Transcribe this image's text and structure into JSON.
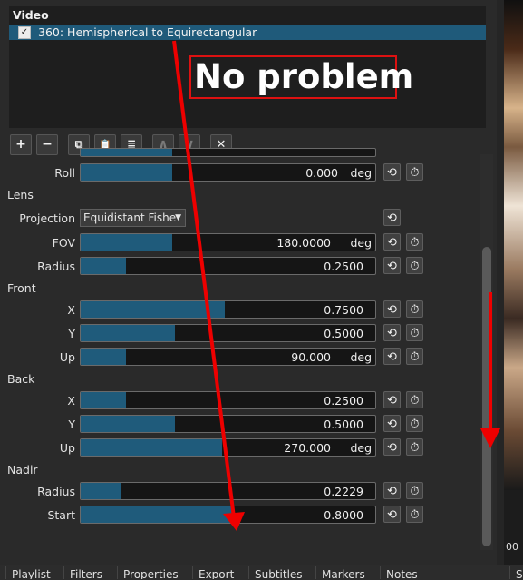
{
  "filter_panel": {
    "header": "Video",
    "selected_filter": "360: Hemispherical to Equirectangular",
    "check_glyph": "✓"
  },
  "toolbar": {
    "add": "+",
    "remove": "−",
    "copy": "⧉",
    "paste": "📋",
    "presets": "≣",
    "up": "∧",
    "down": "∨",
    "close": "✕"
  },
  "params": {
    "roll": {
      "label": "Roll",
      "value": "0.000",
      "unit": "deg",
      "level": 0.31
    },
    "lens_section": "Lens",
    "projection": {
      "label": "Projection",
      "value": "Equidistant Fishe"
    },
    "fov": {
      "label": "FOV",
      "value": "180.0000",
      "unit": "deg",
      "level": 0.31
    },
    "lens_radius": {
      "label": "Radius",
      "value": "0.2500",
      "level": 0.155
    },
    "front_section": "Front",
    "front_x": {
      "label": "X",
      "value": "0.7500",
      "level": 0.49
    },
    "front_y": {
      "label": "Y",
      "value": "0.5000",
      "level": 0.32
    },
    "front_up": {
      "label": "Up",
      "value": "90.000",
      "unit": "deg",
      "level": 0.155
    },
    "back_section": "Back",
    "back_x": {
      "label": "X",
      "value": "0.2500",
      "level": 0.155
    },
    "back_y": {
      "label": "Y",
      "value": "0.5000",
      "level": 0.32
    },
    "back_up": {
      "label": "Up",
      "value": "270.000",
      "unit": "deg",
      "level": 0.48
    },
    "nadir_section": "Nadir",
    "nadir_radius": {
      "label": "Radius",
      "value": "0.2229",
      "level": 0.135
    },
    "nadir_start": {
      "label": "Start",
      "value": "0.8000",
      "level": 0.52
    }
  },
  "icons": {
    "reset": "⟲",
    "keyframe": "⏱"
  },
  "preview": {
    "time": "00"
  },
  "tabs": [
    "Playlist",
    "Filters",
    "Properties",
    "Export",
    "Subtitles",
    "Markers",
    "Notes",
    "S"
  ],
  "annotation": {
    "text": "No problem"
  }
}
